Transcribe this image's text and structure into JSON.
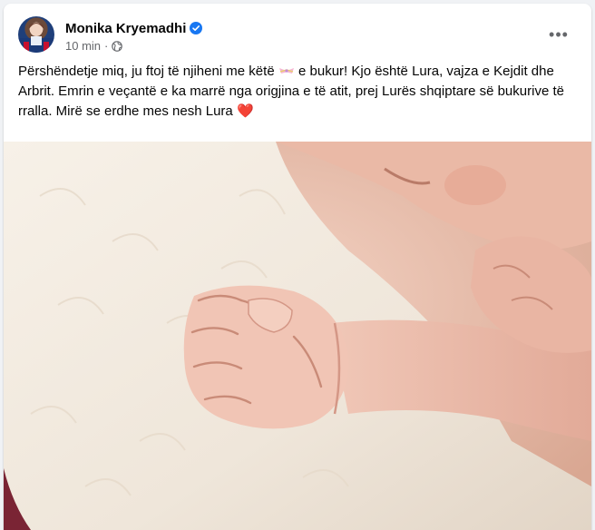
{
  "post": {
    "author": {
      "name": "Monika Kryemadhi",
      "verified": true
    },
    "timestamp": "10 min",
    "separator": "·",
    "audience_icon": "globe-icon",
    "more_icon": "more-options-icon",
    "more_label": "•••",
    "text_part1": "Përshëndetje miq, ju ftoj të njiheni me këtë",
    "emoji_ribbon": "ribbon-emoji",
    "text_part2": " e bukur! Kjo është Lura, vajza e Kejdit dhe Arbrit. Emrin e veçantë e ka marrë nga origjina e të atit, prej Lurës shqiptare së bukurive të rralla. Mirë se erdhe mes nesh Lura",
    "heart_emoji": "❤️",
    "photo": {
      "subject": "sleeping newborn baby hand on white fur blanket"
    }
  },
  "colors": {
    "verified_blue": "#1877f2",
    "text_primary": "#050505",
    "text_secondary": "#65676b",
    "heart": "#e0245e"
  }
}
